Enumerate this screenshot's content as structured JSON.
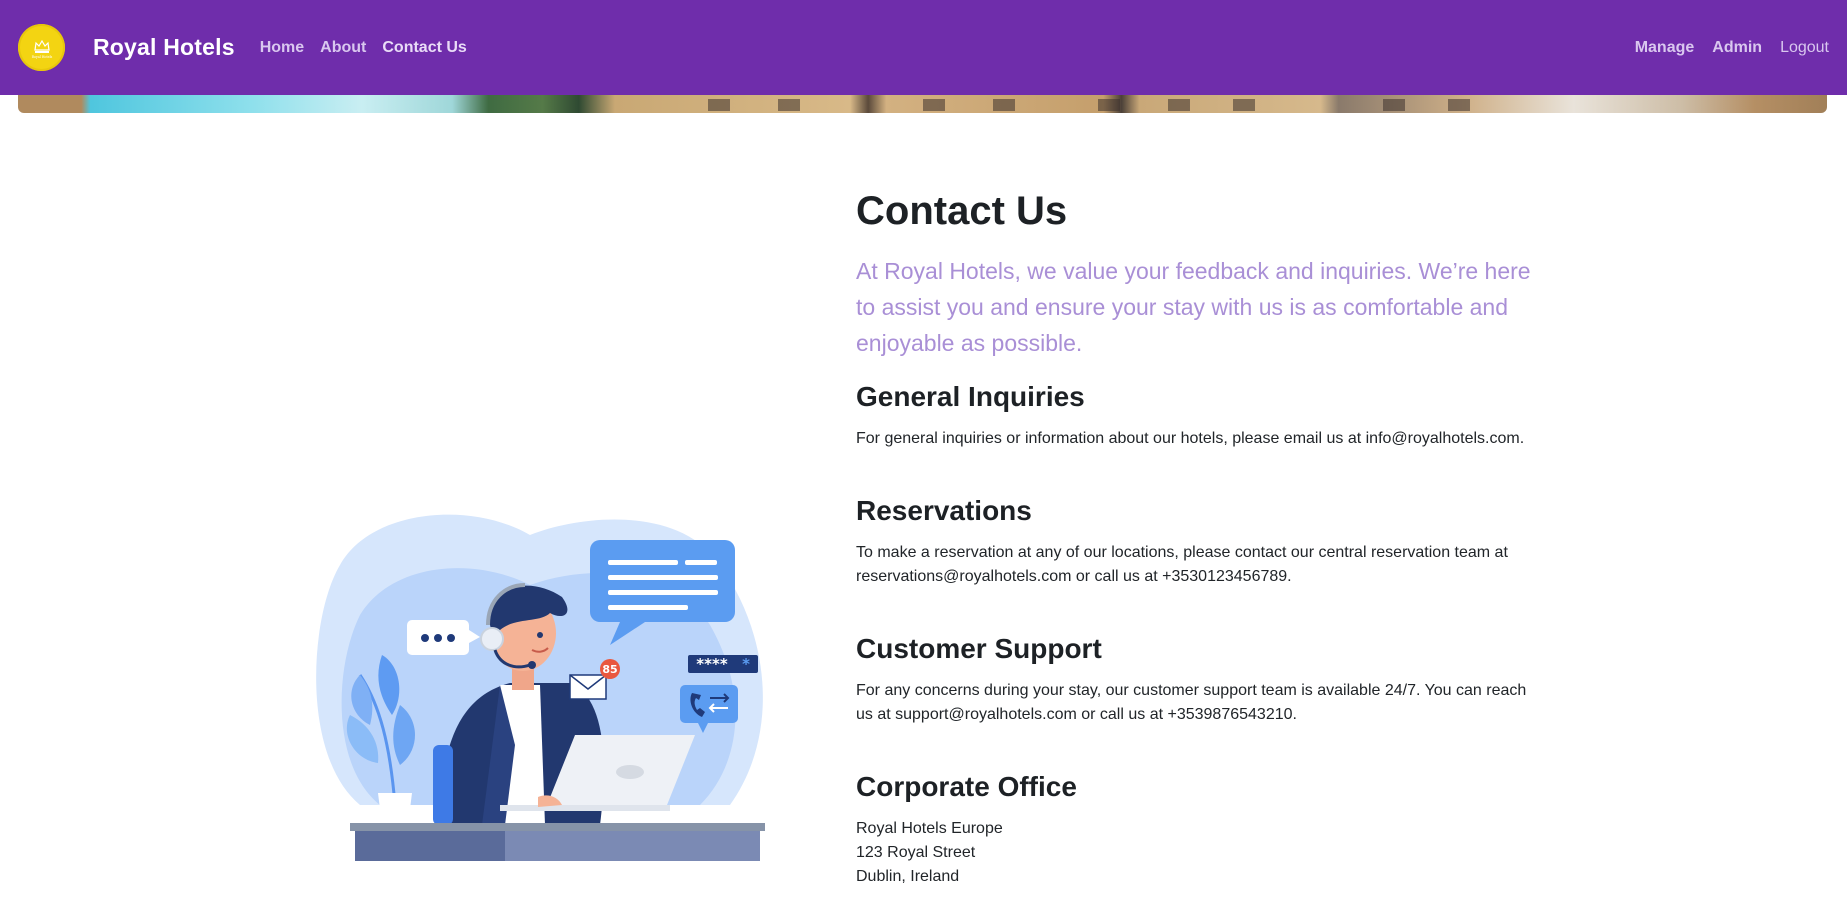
{
  "navbar": {
    "brand": "Royal Hotels",
    "logo_text": "Royal Hotels",
    "left_links": [
      {
        "label": "Home"
      },
      {
        "label": "About"
      },
      {
        "label": "Contact Us"
      }
    ],
    "right_links": [
      {
        "label": "Manage"
      },
      {
        "label": "Admin"
      },
      {
        "label": "Logout"
      }
    ],
    "background_color": "#6f2dab"
  },
  "main": {
    "title": "Contact Us",
    "lead": "At Royal Hotels, we value your feedback and inquiries. We’re here to assist you and ensure your stay with us is as comfortable and enjoyable as possible.",
    "sections": [
      {
        "heading": "General Inquiries",
        "body": "For general inquiries or information about our hotels, please email us at info@royalhotels.com."
      },
      {
        "heading": "Reservations",
        "body": "To make a reservation at any of our locations, please contact our central reservation team at reservations@royalhotels.com or call us at +3530123456789."
      },
      {
        "heading": "Customer Support",
        "body": "For any concerns during your stay, our customer support team is available 24/7. You can reach us at support@royalhotels.com or call us at +3539876543210."
      },
      {
        "heading": "Corporate Office",
        "address": [
          "Royal Hotels Europe",
          "123 Royal Street",
          "Dublin, Ireland"
        ]
      }
    ]
  },
  "illustration": {
    "icon": "customer-support-illustration",
    "notification_count": "85",
    "password_mask": "****",
    "chat_dots": "•••"
  },
  "colors": {
    "accent_purple": "#6f2dab",
    "lead_text": "#a98fd6",
    "logo_yellow": "#f3d412"
  }
}
